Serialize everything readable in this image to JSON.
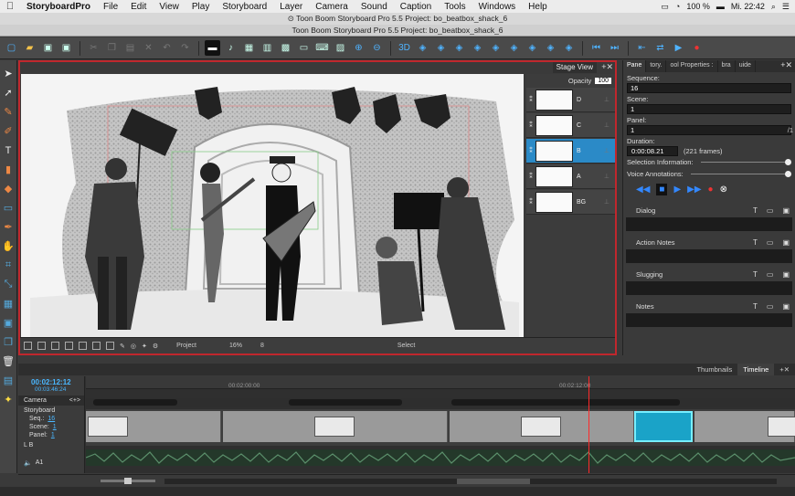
{
  "menubar": {
    "app": "StoryboardPro",
    "items": [
      "File",
      "Edit",
      "View",
      "Play",
      "Storyboard",
      "Layer",
      "Camera",
      "Sound",
      "Caption",
      "Tools",
      "Windows",
      "Help"
    ],
    "battery": "100 %",
    "clock": "Mi. 22:42"
  },
  "window": {
    "title": "Toon Boom Storyboard Pro 5.5 Project: bo_beatbox_shack_6",
    "subtitle": "Toon Boom Storyboard Pro 5.5 Project: bo_beatbox_shack_6"
  },
  "stage": {
    "tab_label": "Stage View",
    "opacity_label": "Opacity",
    "opacity_value": "100",
    "bottom": {
      "project_label": "Project",
      "zoom": "16%",
      "frame": "8",
      "mode": "Select"
    }
  },
  "layers": [
    {
      "name": "D",
      "selected": false
    },
    {
      "name": "C",
      "selected": false
    },
    {
      "name": "B",
      "selected": true
    },
    {
      "name": "A",
      "selected": false
    },
    {
      "name": "BG",
      "selected": false
    }
  ],
  "right_panel": {
    "tabs": [
      "Pane",
      "tory.",
      "ool Properties :",
      "bra",
      "uide"
    ],
    "sequence_label": "Sequence:",
    "sequence_value": "16",
    "scene_label": "Scene:",
    "scene_value": "1",
    "panel_label": "Panel:",
    "panel_value": "1",
    "panel_suffix": "/1",
    "duration_label": "Duration:",
    "duration_value": "0:00:08.21",
    "duration_frames": "(221 frames)",
    "selection_info": "Selection Information:",
    "voice_annotations": "Voice Annotations:",
    "sections": [
      "Dialog",
      "Action Notes",
      "Slugging",
      "Notes"
    ]
  },
  "timeline": {
    "tabs": [
      "Thumbnails",
      "Timeline"
    ],
    "current_time": "00:02:12:12",
    "sub_time": "00:03:46:24",
    "ruler_marks": [
      "00:02:00:00",
      "00:02:12:00"
    ],
    "camera_label": "Camera",
    "storyboard_label": "Storyboard",
    "seq_label": "Seq.:",
    "seq_value": "16",
    "scene_label": "Scene:",
    "scene_value": "1",
    "panel_label": "Panel:",
    "panel_value": "1",
    "lb_label": "L B",
    "audio_label": "A1"
  },
  "colors": {
    "accent_red": "#c0272d",
    "selection_blue": "#2b8ac7",
    "time_blue": "#4ab7ff",
    "panel_cyan": "#1aa3c8"
  }
}
